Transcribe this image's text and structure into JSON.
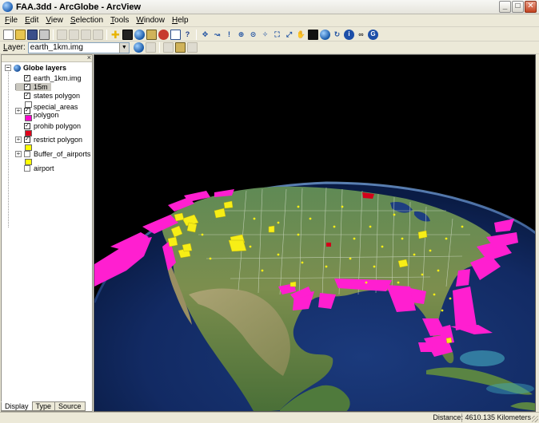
{
  "window": {
    "title": "FAA.3dd - ArcGlobe - ArcView",
    "buttons": {
      "minimize": "_",
      "maximize": "□",
      "close": "✕"
    }
  },
  "menu": [
    "File",
    "Edit",
    "View",
    "Selection",
    "Tools",
    "Window",
    "Help"
  ],
  "toolbar": {
    "layer_label": "Layer:",
    "layer_value": "earth_1km.img"
  },
  "toc": {
    "close": "×",
    "root": "Globe layers",
    "layers": [
      {
        "name": "earth_1km.img",
        "checked": true,
        "symbol": null
      },
      {
        "name": "15m",
        "checked": true,
        "selected": true,
        "expandable": true,
        "symbol": null
      },
      {
        "name": "states polygon",
        "checked": true,
        "symbol": "#ffffff"
      },
      {
        "name": "special_areas polygon",
        "checked": true,
        "expandable": true,
        "symbol": "#ff00cc"
      },
      {
        "name": "prohib polygon",
        "checked": true,
        "symbol": "#e0001b"
      },
      {
        "name": "restrict polygon",
        "checked": true,
        "expandable": true,
        "symbol": "#ffff00"
      },
      {
        "name": "Buffer_of_airports",
        "checked": false,
        "expandable": true,
        "symbol": "#ffff00"
      },
      {
        "name": "airport",
        "checked": false,
        "symbol": null
      }
    ],
    "tabs": [
      "Display",
      "Type",
      "Source"
    ]
  },
  "colors": {
    "magenta": "#ff1fd0",
    "yellow": "#f7ee16",
    "ocean": "#12285e",
    "land": "#6d8a49"
  },
  "status": {
    "distance": "Distance:  4610.135 Kilometers"
  }
}
